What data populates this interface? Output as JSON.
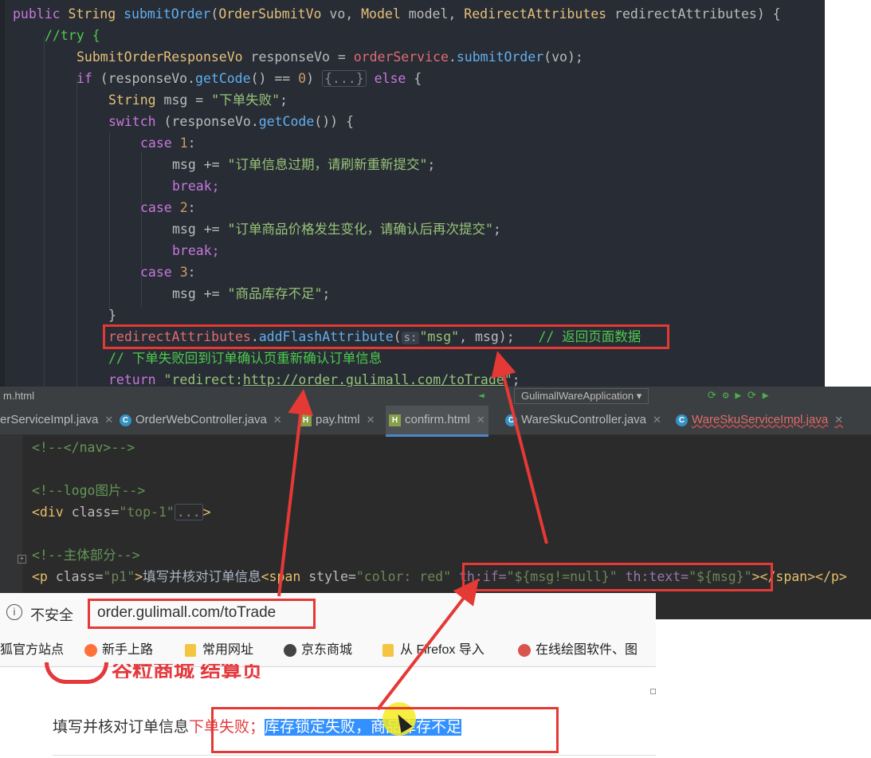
{
  "code_top": {
    "lines": [
      "public String submitOrder(OrderSubmitVo vo, Model model, RedirectAttributes redirectAttributes) {",
      "//try {",
      "SubmitOrderResponseVo responseVo = orderService.submitOrder(vo);",
      "if (responseVo.getCode() == 0) {...} else {",
      "String msg = \"下单失败\";",
      "switch (responseVo.getCode()) {",
      "case 1:",
      "msg += \"订单信息过期，请刷新重新提交\";",
      "break;",
      "case 2:",
      "msg += \"订单商品价格发生变化，请确认后再次提交\";",
      "break;",
      "case 3:",
      "msg += \"商品库存不足\";",
      "}",
      "redirectAttributes.addFlashAttribute(s:\"msg\", msg);   // 返回页面数据",
      "// 下单失败回到订单确认页重新确认订单信息",
      "return \"redirect:http://order.gulimall.com/toTrade\";"
    ],
    "hint_label": "s:",
    "comment_return_data": "// 返回页面数据",
    "comment_fail": "// 下单失败回到订单确认页重新确认订单信息",
    "redirect_url": "http://order.gulimall.com/toTrade"
  },
  "ide": {
    "run_config": "GulimallWareApplication",
    "left_fragment": "m.html",
    "tabs": [
      {
        "label": "erServiceImpl.java",
        "icon": "java-class-icon"
      },
      {
        "label": "OrderWebController.java",
        "icon": "java-class-icon"
      },
      {
        "label": "pay.html",
        "icon": "html-file-icon"
      },
      {
        "label": "confirm.html",
        "icon": "html-file-icon",
        "active": true
      },
      {
        "label": "WareSkuController.java",
        "icon": "java-class-icon"
      },
      {
        "label": "WareSkuServiceImpl.java",
        "icon": "java-class-icon"
      }
    ],
    "html_lines": [
      "<!--</nav>-->",
      "",
      "<!--logo图片-->",
      "<div class=\"top-1\"...>",
      "",
      "<!--主体部分-->",
      "<p class=\"p1\">填写并核对订单信息<span style=\"color: red\" th:if=\"${msg!=null}\" th:text=\"${msg}\"></span></p>"
    ]
  },
  "browser": {
    "security_label": "不安全",
    "url": "order.gulimall.com/toTrade",
    "bookmarks": [
      "狐官方站点",
      "新手上路",
      "常用网址",
      "京东商城",
      "从 Firefox 导入",
      "在线绘图软件、图"
    ],
    "page_heading_fragment": "谷粒商城 结算页",
    "order_info_label": "填写并核对订单信息",
    "error_prefix": "下单失败；",
    "error_selected": "库存锁定失败，商品库存不足"
  },
  "colors": {
    "annotation_red": "#e53935",
    "editor_bg": "#282c34",
    "ide_bg": "#2b2b2b"
  }
}
